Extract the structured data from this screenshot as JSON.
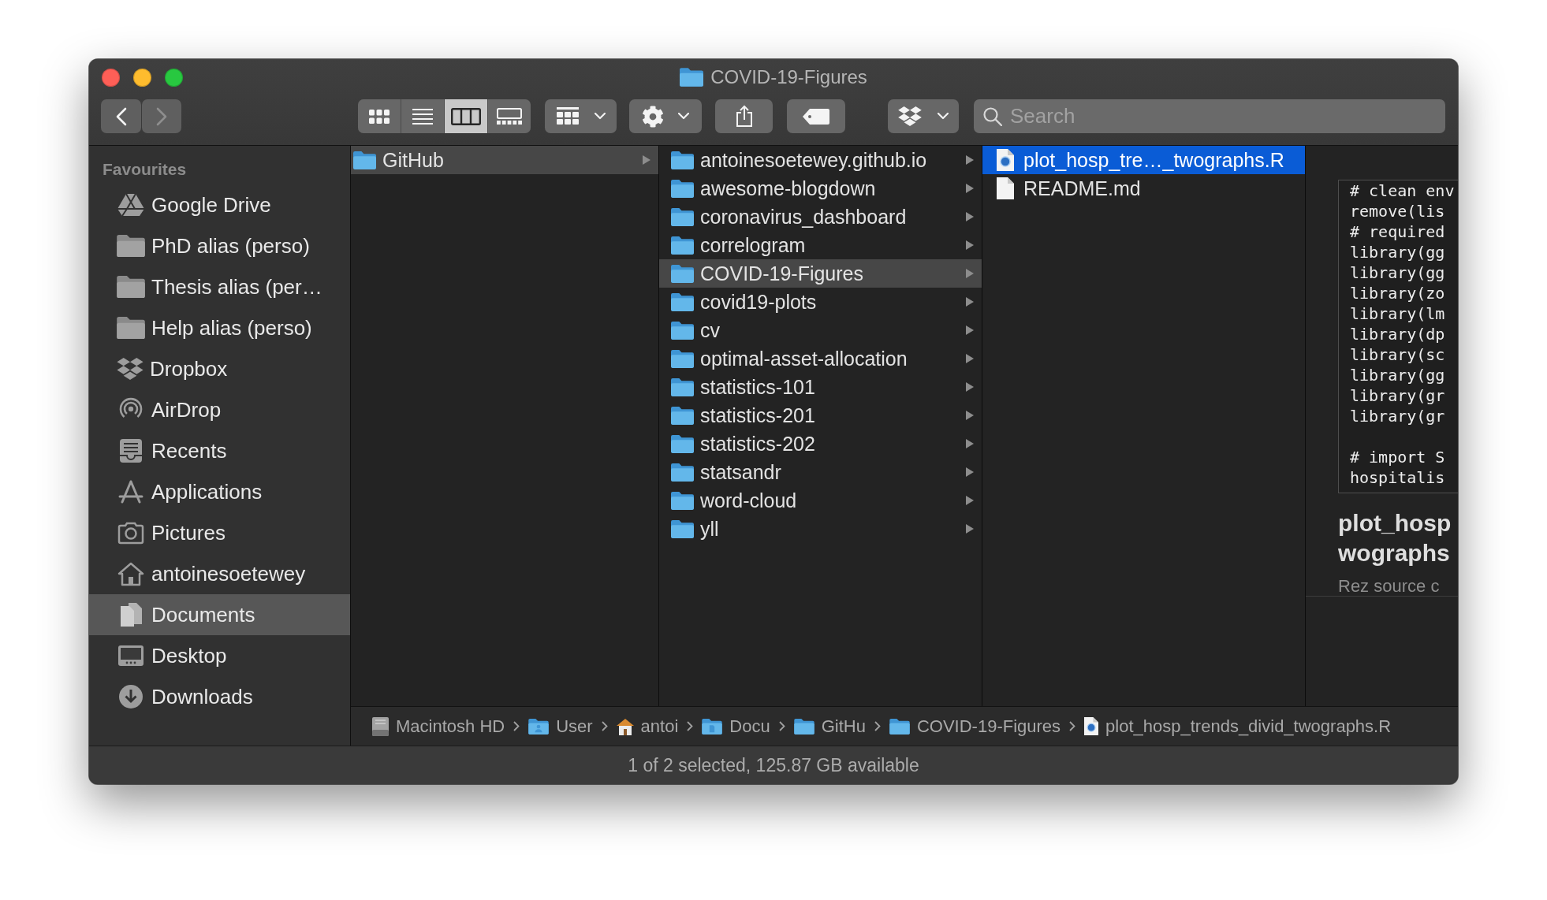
{
  "window": {
    "title": "COVID-19-Figures"
  },
  "toolbar": {
    "navigation": [
      {
        "kind": "back",
        "disabled": false
      },
      {
        "kind": "forward",
        "disabled": true
      }
    ],
    "view_modes": [
      {
        "kind": "icons",
        "selected": false
      },
      {
        "kind": "list",
        "selected": false
      },
      {
        "kind": "columns",
        "selected": true
      },
      {
        "kind": "gallery",
        "selected": false
      }
    ],
    "search": {
      "placeholder": "Search"
    }
  },
  "sidebar": {
    "section": "Favourites",
    "items": [
      {
        "label": "Google Drive",
        "kind": "drive",
        "selected": false
      },
      {
        "label": "PhD alias (perso)",
        "kind": "folder",
        "selected": false
      },
      {
        "label": "Thesis alias (per…",
        "kind": "folder",
        "selected": false
      },
      {
        "label": "Help alias (perso)",
        "kind": "folder",
        "selected": false
      },
      {
        "label": "Dropbox",
        "kind": "dropbox",
        "selected": false
      },
      {
        "label": "AirDrop",
        "kind": "airdrop",
        "selected": false
      },
      {
        "label": "Recents",
        "kind": "recents",
        "selected": false
      },
      {
        "label": "Applications",
        "kind": "applications",
        "selected": false
      },
      {
        "label": "Pictures",
        "kind": "pictures",
        "selected": false
      },
      {
        "label": "antoinesoetewey",
        "kind": "home",
        "selected": false
      },
      {
        "label": "Documents",
        "kind": "documents",
        "selected": true
      },
      {
        "label": "Desktop",
        "kind": "desktop",
        "selected": false
      },
      {
        "label": "Downloads",
        "kind": "downloads",
        "selected": false
      }
    ]
  },
  "columns": [
    {
      "focused": false,
      "items": [
        {
          "name": "GitHub",
          "kind": "folder",
          "selected": true
        }
      ]
    },
    {
      "focused": false,
      "items": [
        {
          "name": "antoinesoetewey.github.io",
          "kind": "folder",
          "selected": false
        },
        {
          "name": "awesome-blogdown",
          "kind": "folder",
          "selected": false
        },
        {
          "name": "coronavirus_dashboard",
          "kind": "folder",
          "selected": false
        },
        {
          "name": "correlogram",
          "kind": "folder",
          "selected": false
        },
        {
          "name": "COVID-19-Figures",
          "kind": "folder",
          "selected": true
        },
        {
          "name": "covid19-plots",
          "kind": "folder",
          "selected": false
        },
        {
          "name": "cv",
          "kind": "folder",
          "selected": false
        },
        {
          "name": "optimal-asset-allocation",
          "kind": "folder",
          "selected": false
        },
        {
          "name": "statistics-101",
          "kind": "folder",
          "selected": false
        },
        {
          "name": "statistics-201",
          "kind": "folder",
          "selected": false
        },
        {
          "name": "statistics-202",
          "kind": "folder",
          "selected": false
        },
        {
          "name": "statsandr",
          "kind": "folder",
          "selected": false
        },
        {
          "name": "word-cloud",
          "kind": "folder",
          "selected": false
        },
        {
          "name": "yll",
          "kind": "folder",
          "selected": false
        }
      ]
    },
    {
      "focused": true,
      "items": [
        {
          "name": "plot_hosp_tre…_twographs.R",
          "kind": "r-script",
          "selected": true
        },
        {
          "name": "README.md",
          "kind": "document",
          "selected": false
        }
      ]
    }
  ],
  "preview": {
    "code_blocks": [
      [
        "# clean env",
        "remove(lis",
        "# required",
        "library(gg",
        "library(gg",
        "library(zo",
        "library(lm",
        "library(dp",
        "library(sc",
        "library(gg",
        "library(gr",
        "library(gr"
      ],
      [
        "# import S",
        "hospitalis"
      ]
    ],
    "title_lines": [
      "plot_hosp",
      "wographs"
    ],
    "subtitle": "Rez source c"
  },
  "path_bar": [
    {
      "label": "Macintosh HD",
      "kind": "drive"
    },
    {
      "label": "User",
      "kind": "users-folder"
    },
    {
      "label": "antoi",
      "kind": "home"
    },
    {
      "label": "Docu",
      "kind": "documents-folder"
    },
    {
      "label": "GitHu",
      "kind": "folder"
    },
    {
      "label": "COVID-19-Figures",
      "kind": "folder"
    },
    {
      "label": "plot_hosp_trends_divid_twographs.R",
      "kind": "r-script"
    }
  ],
  "status_bar": "1 of 2 selected, 125.87 GB available"
}
